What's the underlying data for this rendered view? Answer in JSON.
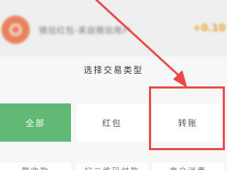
{
  "list_item": {
    "text": "微信红包-来自微信用户",
    "amount": "+0.10"
  },
  "sheet": {
    "title": "选择交易类型",
    "types": [
      {
        "label": "全部",
        "selected": true
      },
      {
        "label": "红包",
        "selected": false
      },
      {
        "label": "转账",
        "selected": false
      }
    ],
    "types_row2": [
      {
        "label": "群收款"
      },
      {
        "label": "扫二维码付款"
      },
      {
        "label": "商户消费"
      }
    ]
  },
  "colors": {
    "selected_bg": "#5fb873",
    "annotation_red": "#e84a4a",
    "amount_color": "#e9a030"
  }
}
